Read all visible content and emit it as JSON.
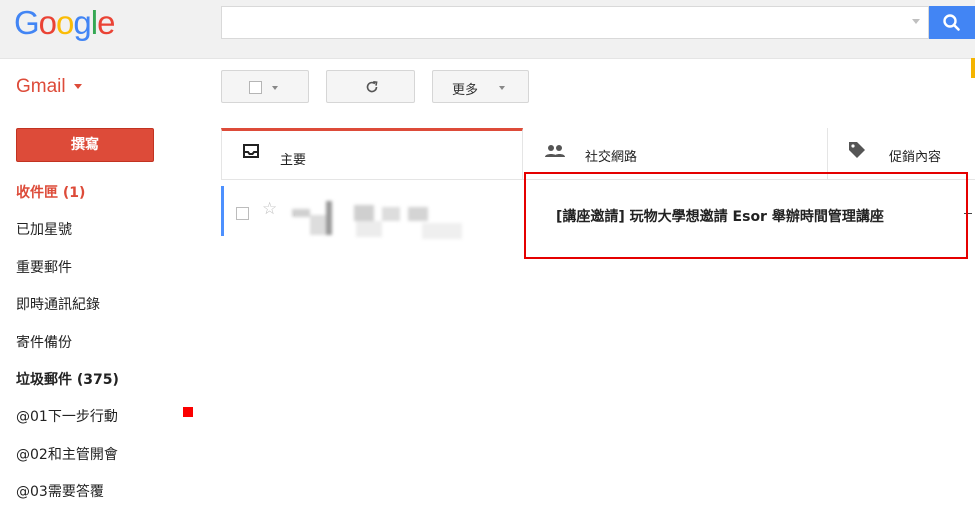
{
  "header": {
    "logo": {
      "letters": [
        "G",
        "o",
        "o",
        "g",
        "l",
        "e"
      ]
    },
    "search": {
      "value": "",
      "placeholder": ""
    },
    "search_button_icon": "search-icon",
    "accent_color": "#4285f4"
  },
  "toolbar": {
    "app_switcher_label": "Gmail",
    "select_icon": "checkbox-icon",
    "refresh_icon": "refresh-icon",
    "more_label": "更多"
  },
  "sidebar": {
    "compose_label": "撰寫",
    "items": [
      {
        "label": "收件匣 (1)",
        "state": "active"
      },
      {
        "label": "已加星號"
      },
      {
        "label": "重要郵件"
      },
      {
        "label": "即時通訊紀錄"
      },
      {
        "label": "寄件備份"
      },
      {
        "label": "垃圾郵件 (375)",
        "state": "bold"
      },
      {
        "label": "@01下一步行動",
        "label_color": "#fb0000"
      },
      {
        "label": "@02和主管開會"
      },
      {
        "label": "@03需要答覆"
      }
    ]
  },
  "tabs": [
    {
      "label": "主要",
      "icon": "inbox-icon",
      "selected": true
    },
    {
      "label": "社交網路",
      "icon": "people-icon"
    },
    {
      "label": "促銷內容",
      "icon": "tag-icon"
    }
  ],
  "email_list": [
    {
      "sender": "",
      "subject_prefix": "[講座邀請]",
      "subject": "玩物大學想邀請 Esor 舉辦時間管理講座",
      "starred": false,
      "selected": false
    }
  ],
  "annotation": {
    "highlight_color": "#e50000"
  }
}
